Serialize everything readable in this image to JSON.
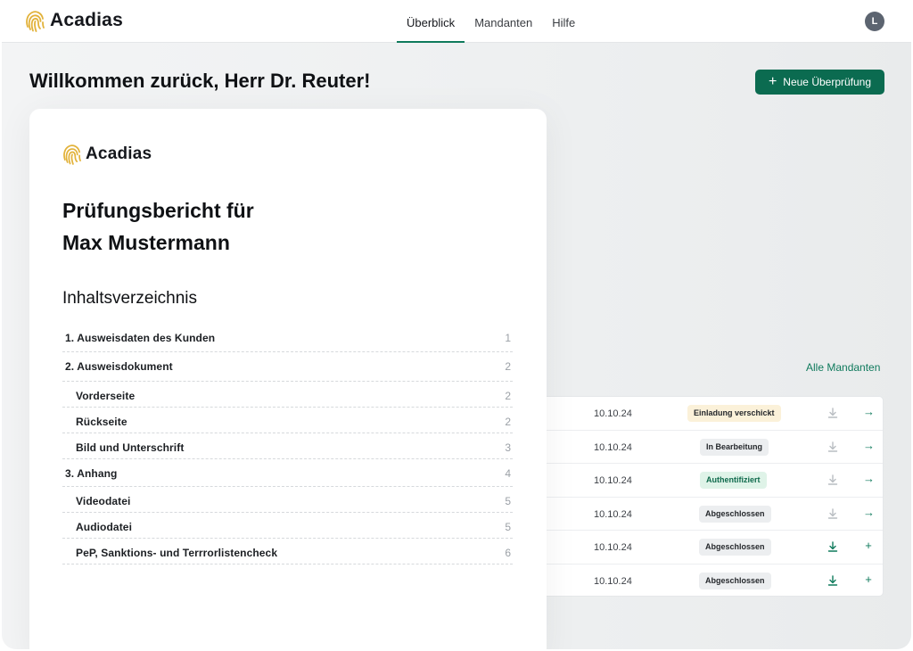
{
  "brand": {
    "name": "Acadias",
    "color": "#e2b23a",
    "accent": "#0b6b50"
  },
  "nav": {
    "items": [
      {
        "label": "Überblick",
        "active": true
      },
      {
        "label": "Mandanten",
        "active": false
      },
      {
        "label": "Hilfe",
        "active": false
      }
    ],
    "avatar_initial": "L"
  },
  "main": {
    "greeting": "Willkommen zurück, Herr Dr. Reuter!",
    "new_review_label": "Neue Überprüfung",
    "all_clients_label": "Alle Mandanten"
  },
  "table": {
    "rows": [
      {
        "date": "10.10.24",
        "status": "Einladung verschickt",
        "status_kind": "warn",
        "download_active": false,
        "action_icon": "arrow-right-icon",
        "action_glyph": "→"
      },
      {
        "date": "10.10.24",
        "status": "In Bearbeitung",
        "status_kind": "neutral",
        "download_active": false,
        "action_icon": "arrow-right-icon",
        "action_glyph": "→"
      },
      {
        "date": "10.10.24",
        "status": "Authentifiziert",
        "status_kind": "ok",
        "download_active": false,
        "action_icon": "arrow-right-icon",
        "action_glyph": "→"
      },
      {
        "date": "10.10.24",
        "status": "Abgeschlossen",
        "status_kind": "neutral",
        "download_active": false,
        "action_icon": "arrow-right-icon",
        "action_glyph": "→"
      },
      {
        "date": "10.10.24",
        "status": "Abgeschlossen",
        "status_kind": "neutral",
        "download_active": true,
        "action_icon": "plus-icon",
        "action_glyph": "+"
      },
      {
        "date": "10.10.24",
        "status": "Abgeschlossen",
        "status_kind": "neutral",
        "download_active": true,
        "action_icon": "plus-icon",
        "action_glyph": "+"
      }
    ]
  },
  "report": {
    "brand": "Acadias",
    "title_line1": "Prüfungsbericht für",
    "title_line2": "Max Mustermann",
    "toc_title": "Inhaltsverzeichnis",
    "toc": [
      {
        "label": "1. Ausweisdaten des Kunden",
        "page": "1",
        "sub": false
      },
      {
        "label": "2. Ausweisdokument",
        "page": "2",
        "sub": false
      },
      {
        "label": "Vorderseite",
        "page": "2",
        "sub": true
      },
      {
        "label": "Rückseite",
        "page": "2",
        "sub": true
      },
      {
        "label": "Bild und Unterschrift",
        "page": "3",
        "sub": true
      },
      {
        "label": "3. Anhang",
        "page": "4",
        "sub": false
      },
      {
        "label": "Videodatei",
        "page": "5",
        "sub": true
      },
      {
        "label": "Audiodatei",
        "page": "5",
        "sub": true
      },
      {
        "label": "PeP, Sanktions- und Terrrorlistencheck",
        "page": "6",
        "sub": true
      }
    ]
  }
}
